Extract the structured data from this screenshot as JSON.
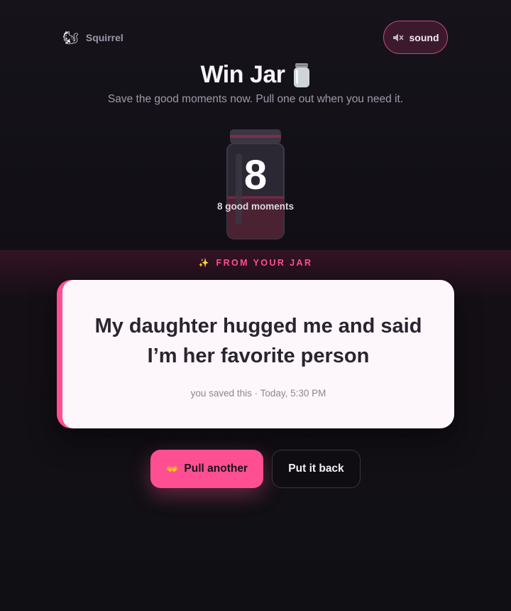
{
  "brand": {
    "icon": "squirrel-icon",
    "icon_glyph": "🐿",
    "name": "Squirrel"
  },
  "sound_button": {
    "icon": "speaker-muted-icon",
    "label": "sound"
  },
  "header": {
    "title": "Win Jar",
    "title_icon": "jar-icon",
    "subtitle": "Save the good moments now. Pull one out when you need it."
  },
  "jar": {
    "count": "8",
    "count_label": "8 good moments",
    "fill_fraction": 0.45
  },
  "section": {
    "sparkle": "✨",
    "label": "FROM YOUR JAR"
  },
  "moment": {
    "text": "My daughter hugged me and said I’m her favorite person",
    "meta": "you saved this · Today, 5:30 PM"
  },
  "actions": {
    "pull_icon": "open-hands-icon",
    "pull_glyph": "👐",
    "pull_label": "Pull another",
    "put_back_label": "Put it back"
  },
  "colors": {
    "accent": "#ff4f93",
    "background": "#121016",
    "card": "#fdf7fb"
  }
}
